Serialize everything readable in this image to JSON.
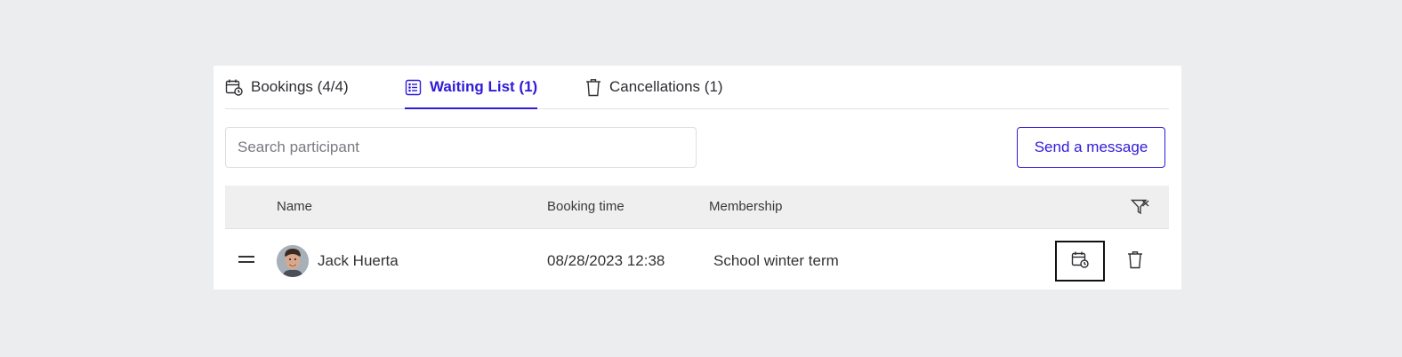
{
  "tabs": [
    {
      "label": "Bookings (4/4)",
      "icon": "calendar-clock-icon",
      "active": false
    },
    {
      "label": "Waiting List (1)",
      "icon": "list-icon",
      "active": true
    },
    {
      "label": "Cancellations (1)",
      "icon": "trash-icon",
      "active": false
    }
  ],
  "search": {
    "placeholder": "Search participant",
    "value": ""
  },
  "actions": {
    "send_message_label": "Send a message"
  },
  "table": {
    "columns": [
      "Name",
      "Booking time",
      "Membership"
    ],
    "rows": [
      {
        "name": "Jack Huerta",
        "booking_time": "08/28/2023 12:38",
        "membership": "School winter term"
      }
    ]
  },
  "colors": {
    "accent": "#2f1bd9",
    "background": "#ecedef",
    "header_bg": "#efefef"
  }
}
